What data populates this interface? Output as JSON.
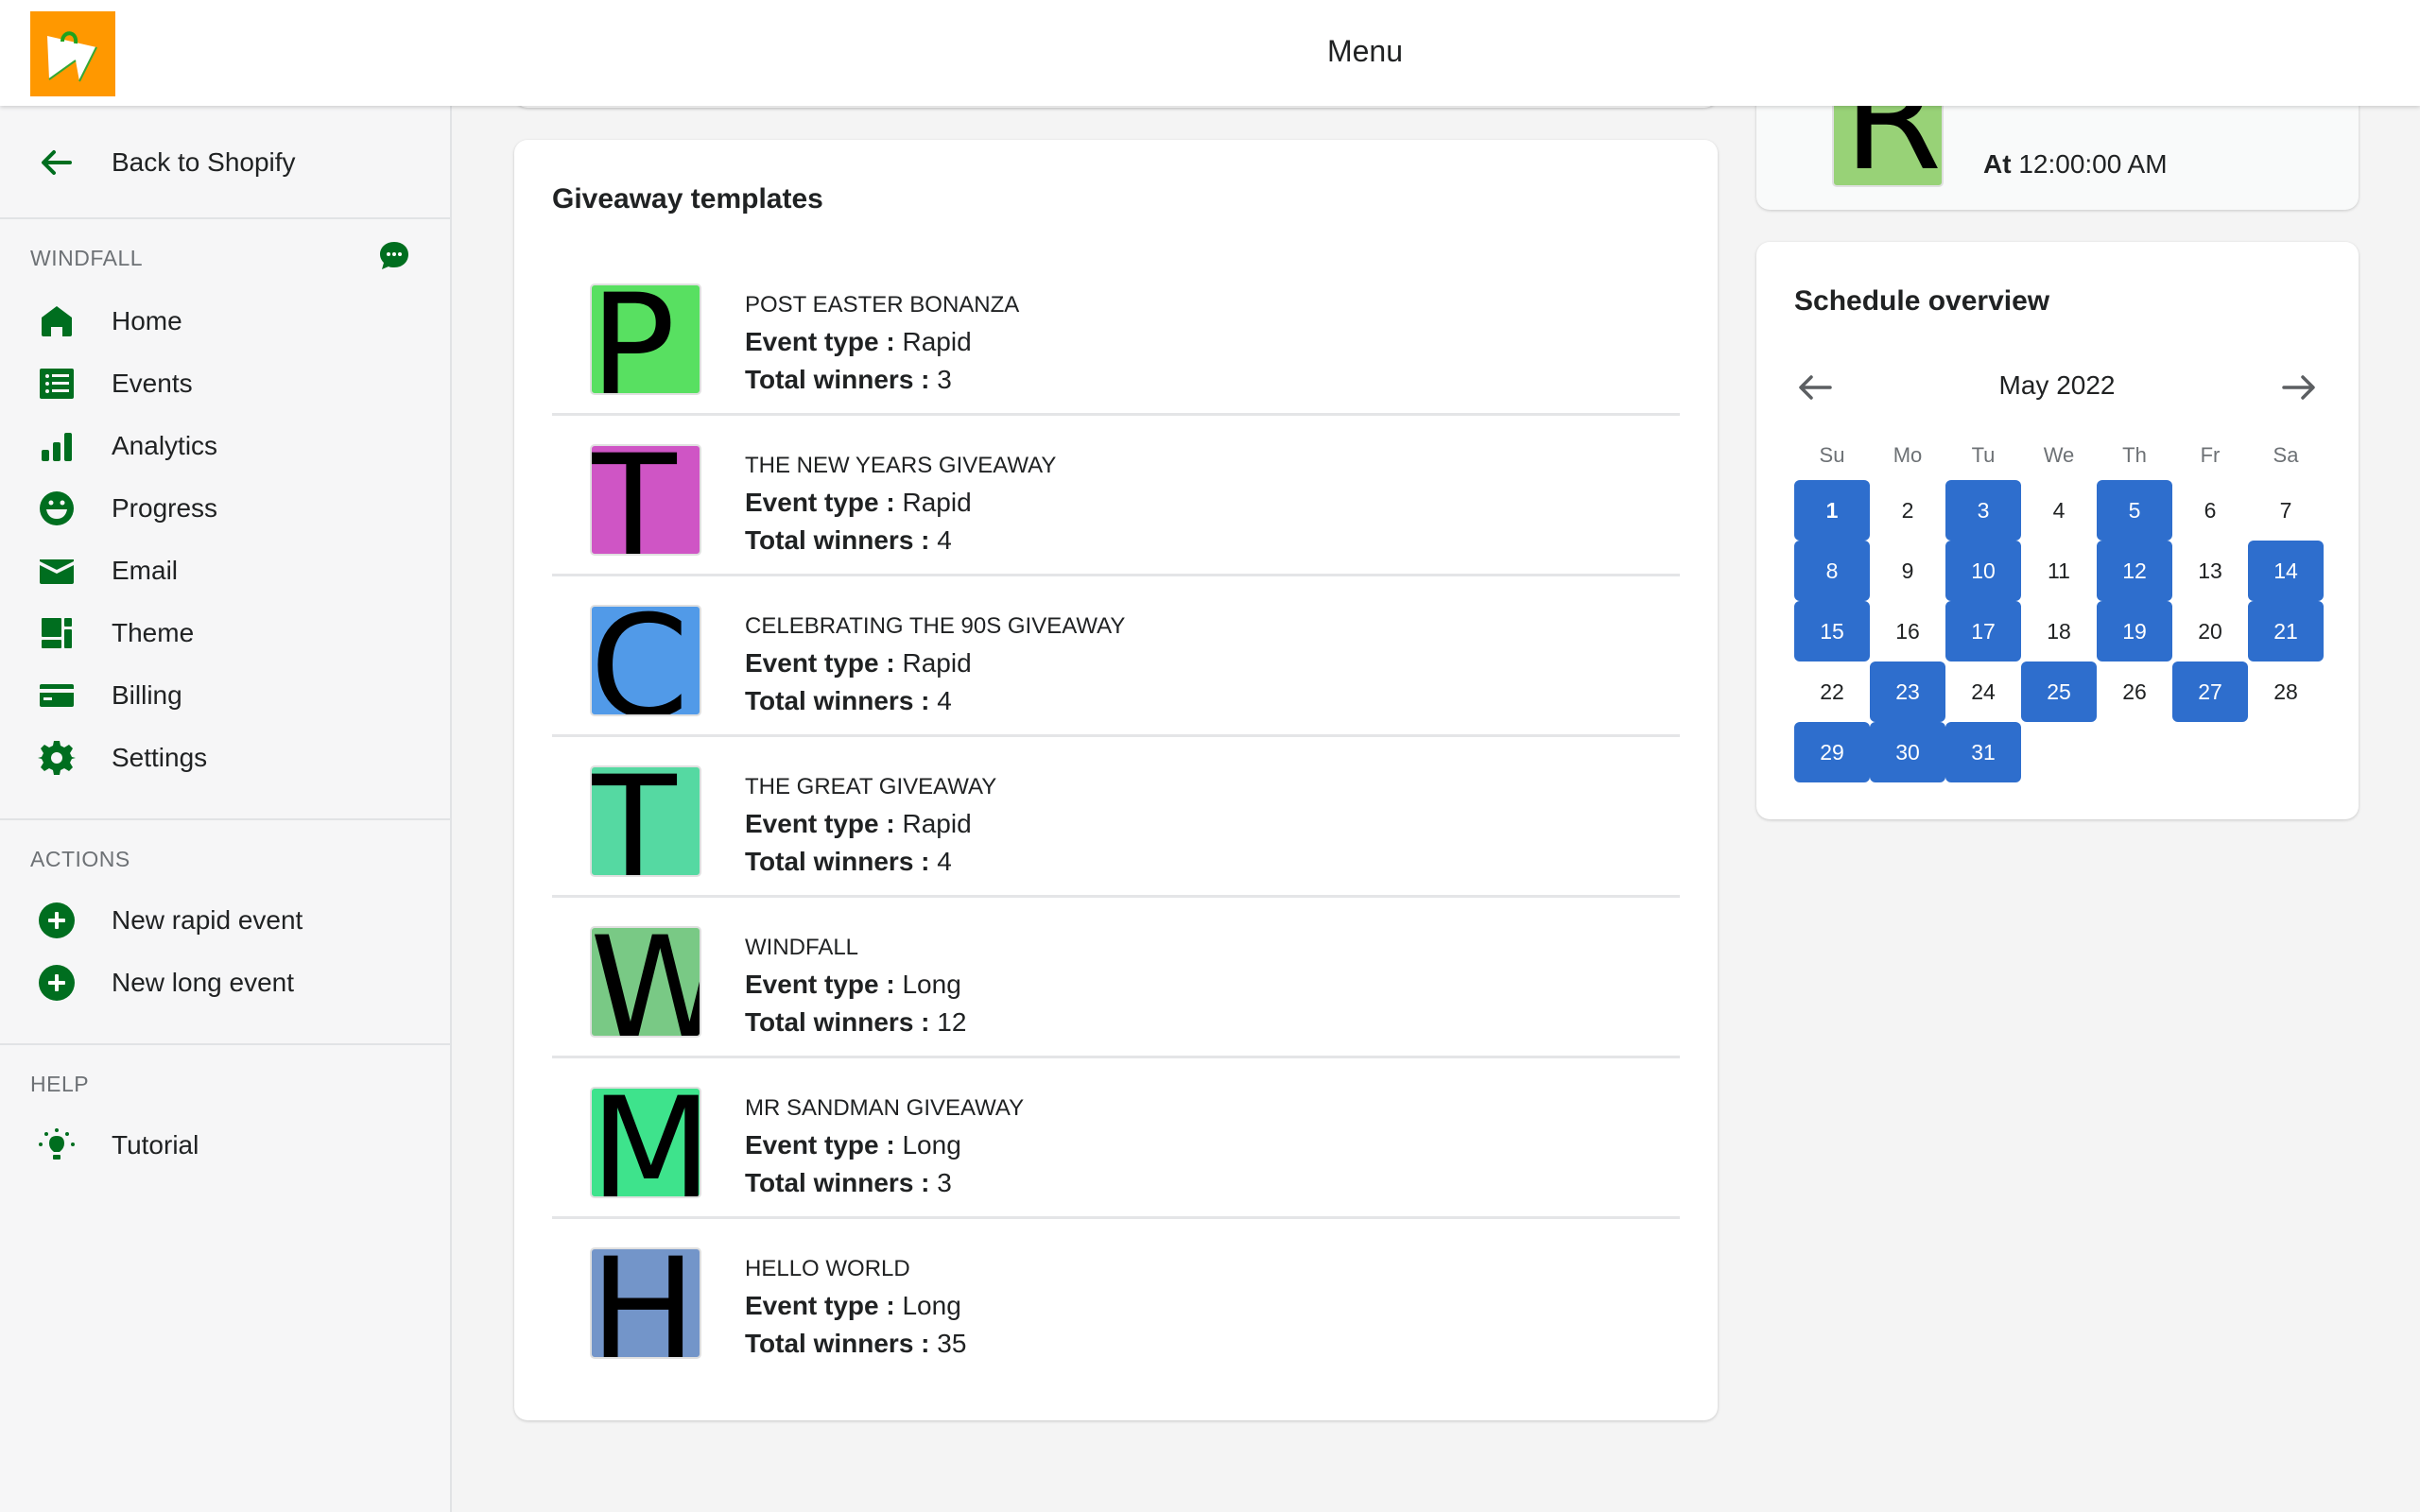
{
  "header": {
    "title": "Menu",
    "logo_alt": "Windfall logo"
  },
  "sidebar": {
    "back_label": "Back to Shopify",
    "sections": [
      {
        "label": "WINDFALL",
        "items": [
          {
            "label": "Home",
            "icon": "home-icon"
          },
          {
            "label": "Events",
            "icon": "list-icon"
          },
          {
            "label": "Analytics",
            "icon": "bar-chart-icon"
          },
          {
            "label": "Progress",
            "icon": "smiley-icon"
          },
          {
            "label": "Email",
            "icon": "mail-icon"
          },
          {
            "label": "Theme",
            "icon": "layout-icon"
          },
          {
            "label": "Billing",
            "icon": "credit-card-icon"
          },
          {
            "label": "Settings",
            "icon": "gear-icon"
          }
        ]
      },
      {
        "label": "ACTIONS",
        "items": [
          {
            "label": "New rapid event",
            "icon": "plus-circle-icon"
          },
          {
            "label": "New long event",
            "icon": "plus-circle-icon"
          }
        ]
      },
      {
        "label": "HELP",
        "items": [
          {
            "label": "Tutorial",
            "icon": "lightbulb-icon"
          }
        ]
      }
    ],
    "accent_color": "#006e1f"
  },
  "templates": {
    "title": "Giveaway templates",
    "event_type_label": "Event type :",
    "winners_label": "Total winners :",
    "items": [
      {
        "initial": "P",
        "name": "POST EASTER BONANZA",
        "event_type": "Rapid",
        "total_winners": "3",
        "color": "#58e061"
      },
      {
        "initial": "T",
        "name": "THE NEW YEARS GIVEAWAY",
        "event_type": "Rapid",
        "total_winners": "4",
        "color": "#cf55c5"
      },
      {
        "initial": "C",
        "name": "CELEBRATING THE 90S GIVEAWAY",
        "event_type": "Rapid",
        "total_winners": "4",
        "color": "#519ae8"
      },
      {
        "initial": "T",
        "name": "THE GREAT GIVEAWAY",
        "event_type": "Rapid",
        "total_winners": "4",
        "color": "#55d9a2"
      },
      {
        "initial": "W",
        "name": "WINDFALL",
        "event_type": "Long",
        "total_winners": "12",
        "color": "#79c985"
      },
      {
        "initial": "M",
        "name": "MR SANDMAN GIVEAWAY",
        "event_type": "Long",
        "total_winners": "3",
        "color": "#3ee38c"
      },
      {
        "initial": "H",
        "name": "HELLO WORLD",
        "event_type": "Long",
        "total_winners": "35",
        "color": "#7395c9"
      }
    ]
  },
  "event_card": {
    "initial": "R",
    "at_label": "At",
    "time": "12:00:00 AM"
  },
  "schedule": {
    "title": "Schedule overview",
    "month": "May 2022",
    "weekdays": [
      "Su",
      "Mo",
      "Tu",
      "We",
      "Th",
      "Fr",
      "Sa"
    ],
    "first_weekday_index": 0,
    "days_in_month": 31,
    "today": 1,
    "scheduled_days": [
      1,
      3,
      5,
      8,
      10,
      12,
      14,
      15,
      17,
      19,
      21,
      23,
      25,
      27,
      29,
      30,
      31
    ],
    "highlight_color": "#2e6ecd"
  }
}
